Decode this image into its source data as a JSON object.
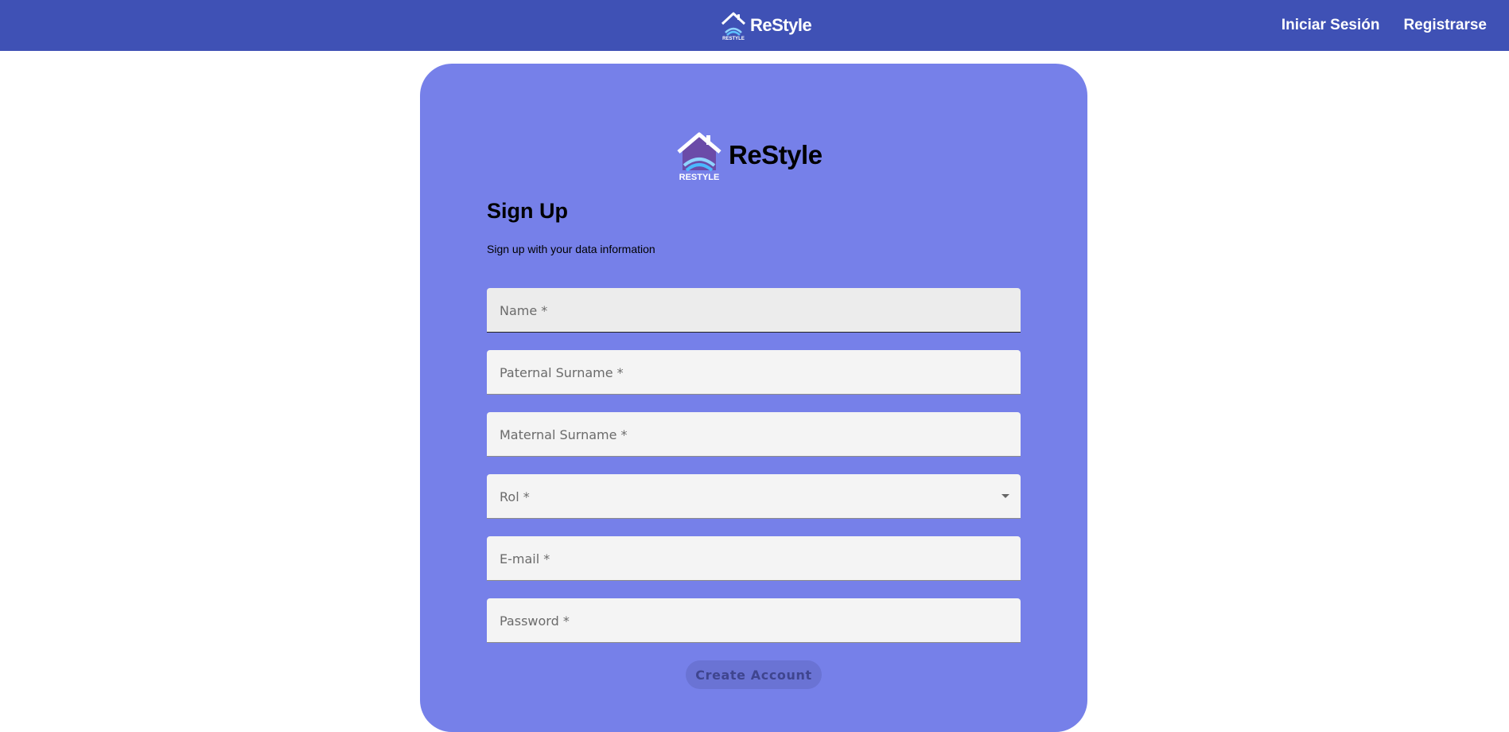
{
  "nav": {
    "brand": "ReStyle",
    "login_label": "Iniciar Sesión",
    "register_label": "Registrarse"
  },
  "logo": {
    "wordmark": "RESTYLE"
  },
  "card": {
    "brand": "ReStyle",
    "title": "Sign Up",
    "subtitle": "Sign up with your data information",
    "submit_label": "Create Account"
  },
  "form": {
    "fields": [
      {
        "label": "Name *",
        "value": ""
      },
      {
        "label": "Paternal Surname *",
        "value": ""
      },
      {
        "label": "Maternal Surname *",
        "value": ""
      },
      {
        "label": "Rol *",
        "value": ""
      },
      {
        "label": "E-mail *",
        "value": ""
      },
      {
        "label": "Password *",
        "value": ""
      }
    ]
  },
  "colors": {
    "navbar": "#3f51b5",
    "card": "#7680e9",
    "field": "#f4f4f4",
    "button": "#6a73d4"
  }
}
